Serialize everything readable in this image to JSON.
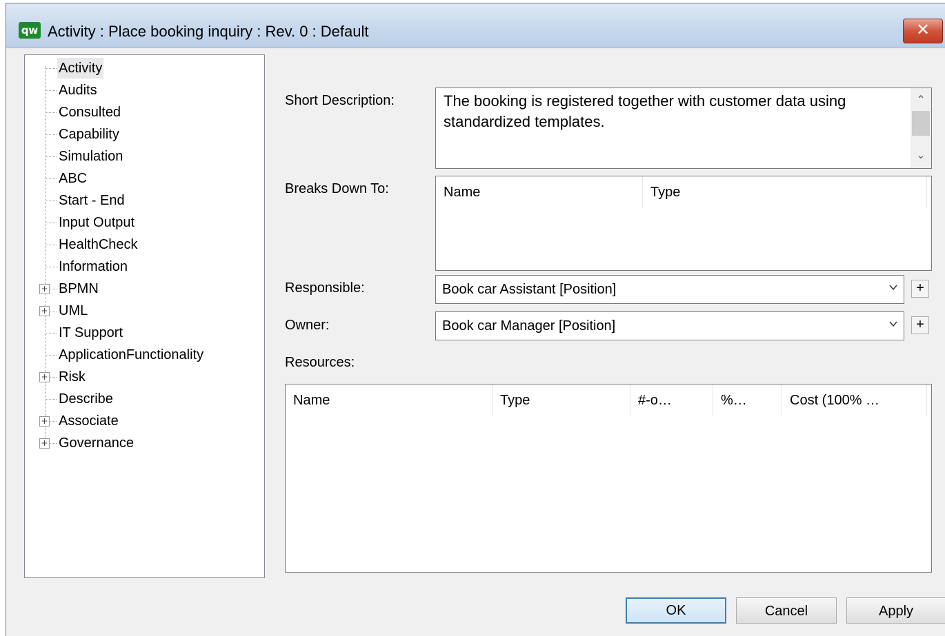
{
  "window": {
    "title": "Activity : Place booking inquiry : Rev. 0  : Default",
    "app_icon_text": "qw",
    "close_symbol": "✕"
  },
  "tree": {
    "items": [
      {
        "label": "Activity",
        "expandable": false,
        "selected": true
      },
      {
        "label": "Audits",
        "expandable": false
      },
      {
        "label": "Consulted",
        "expandable": false
      },
      {
        "label": "Capability",
        "expandable": false
      },
      {
        "label": "Simulation",
        "expandable": false
      },
      {
        "label": "ABC",
        "expandable": false
      },
      {
        "label": "Start - End",
        "expandable": false
      },
      {
        "label": "Input Output",
        "expandable": false
      },
      {
        "label": "HealthCheck",
        "expandable": false
      },
      {
        "label": "Information",
        "expandable": false
      },
      {
        "label": "BPMN",
        "expandable": true
      },
      {
        "label": "UML",
        "expandable": true
      },
      {
        "label": "IT Support",
        "expandable": false
      },
      {
        "label": "ApplicationFunctionality",
        "expandable": false
      },
      {
        "label": "Risk",
        "expandable": true
      },
      {
        "label": "Describe",
        "expandable": false
      },
      {
        "label": "Associate",
        "expandable": true
      },
      {
        "label": "Governance",
        "expandable": true
      }
    ]
  },
  "form": {
    "short_description_label": "Short Description:",
    "short_description_value": "The booking is registered together with customer data using standardized templates.",
    "breaks_down_label": "Breaks Down To:",
    "breaks_down_columns": [
      "Name",
      "Type"
    ],
    "responsible_label": "Responsible:",
    "responsible_value": "Book car Assistant [Position]",
    "owner_label": "Owner:",
    "owner_value": "Book car Manager [Position]",
    "resources_label": "Resources:",
    "resources_columns": [
      "Name",
      "Type",
      "#-o…",
      "%…",
      "Cost (100% …"
    ]
  },
  "buttons": {
    "ok": "OK",
    "cancel": "Cancel",
    "apply": "Apply",
    "plus": "+"
  }
}
